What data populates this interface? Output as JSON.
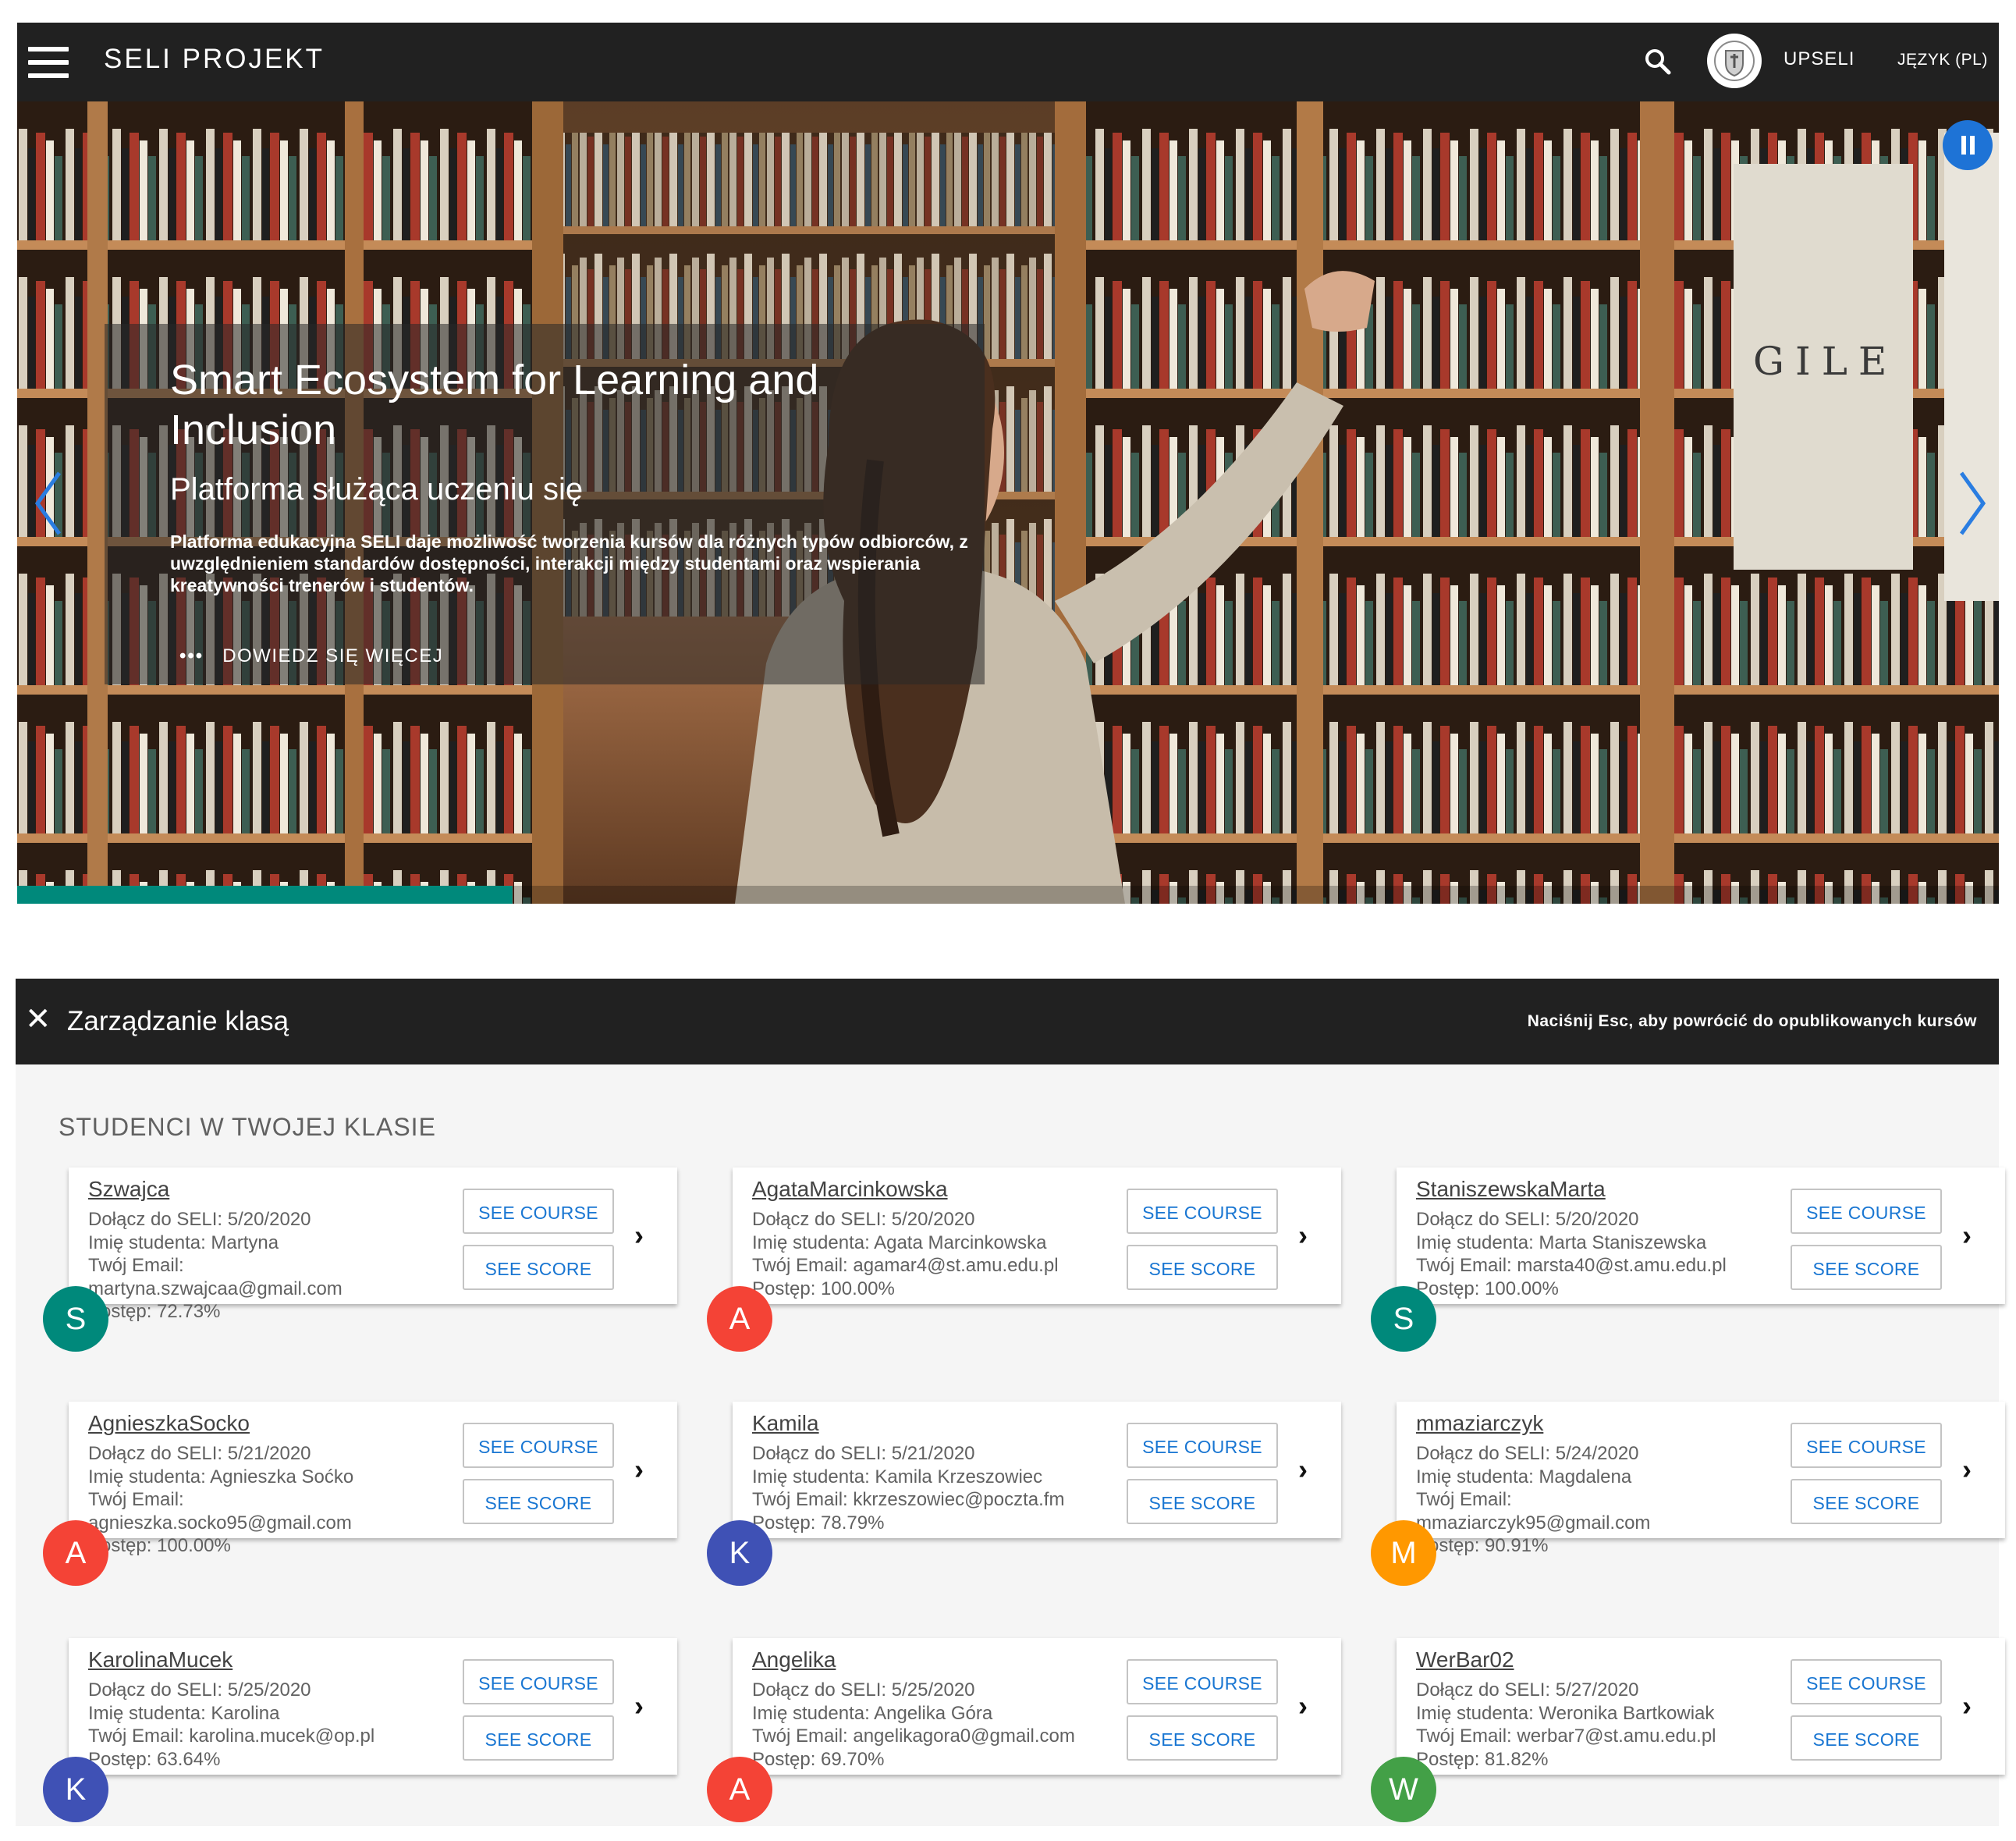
{
  "app": {
    "title": "SELI PROJEKT",
    "user_name": "UPSELI",
    "language": "JĘZYK (PL)"
  },
  "hero": {
    "title": "Smart Ecosystem for Learning and Inclusion",
    "subtitle": "Platforma służąca uczeniu się",
    "text": "Platforma edukacyjna SELI daje możliwość tworzenia kursów dla różnych typów odbiorców, z uwzględnieniem standardów dostępności, interakcji między studentami oraz wspierania kreatywności trenerów i studentów.",
    "more_dots": "•••",
    "more_label": "DOWIEDZ SIĘ WIĘCEJ",
    "slide_progress": 0.25,
    "shelf_sign": "GILE"
  },
  "class_management": {
    "close_glyph": "✕",
    "title": "Zarządzanie klasą",
    "hint": "Naciśnij Esc, aby powrócić do opublikowanych kursów",
    "section_title": "STUDENCI W TWOJEJ KLASIE"
  },
  "buttons": {
    "see_course": "SEE COURSE",
    "see_score": "SEE SCORE"
  },
  "students": [
    {
      "username": "Szwajca",
      "initial": "S",
      "color": "#00897b",
      "lines": [
        "Dołącz do SELI: 5/20/2020",
        "Imię studenta: Martyna",
        "Twój Email:",
        "martyna.szwajcaa@gmail.com",
        "Postęp: 72.73%"
      ]
    },
    {
      "username": "AgataMarcinkowska",
      "initial": "A",
      "color": "#f44336",
      "lines": [
        "Dołącz do SELI: 5/20/2020",
        "Imię studenta: Agata Marcinkowska",
        "Twój Email: agamar4@st.amu.edu.pl",
        "Postęp: 100.00%"
      ]
    },
    {
      "username": "StaniszewskaMarta",
      "initial": "S",
      "color": "#00897b",
      "lines": [
        "Dołącz do SELI: 5/20/2020",
        "Imię studenta: Marta Staniszewska",
        "Twój Email: marsta40@st.amu.edu.pl",
        "Postęp: 100.00%"
      ]
    },
    {
      "username": "AgnieszkaSocko",
      "initial": "A",
      "color": "#f44336",
      "lines": [
        "Dołącz do SELI: 5/21/2020",
        "Imię studenta: Agnieszka Soćko",
        "Twój Email:",
        "agnieszka.socko95@gmail.com",
        "Postęp: 100.00%"
      ]
    },
    {
      "username": "Kamila",
      "initial": "K",
      "color": "#3f51b5",
      "lines": [
        "Dołącz do SELI: 5/21/2020",
        "Imię studenta: Kamila Krzeszowiec",
        "Twój Email: kkrzeszowiec@poczta.fm",
        "Postęp: 78.79%"
      ]
    },
    {
      "username": "mmaziarczyk",
      "initial": "M",
      "color": "#ff9800",
      "lines": [
        "Dołącz do SELI: 5/24/2020",
        "Imię studenta: Magdalena",
        "Twój Email:",
        "mmaziarczyk95@gmail.com",
        "Postęp: 90.91%"
      ]
    },
    {
      "username": "KarolinaMucek",
      "initial": "K",
      "color": "#3f51b5",
      "lines": [
        "Dołącz do SELI: 5/25/2020",
        "Imię studenta: Karolina",
        "Twój Email: karolina.mucek@op.pl",
        "Postęp: 63.64%"
      ]
    },
    {
      "username": "Angelika",
      "initial": "A",
      "color": "#f44336",
      "lines": [
        "Dołącz do SELI: 5/25/2020",
        "Imię studenta: Angelika Góra",
        "Twój Email: angelikagora0@gmail.com",
        "Postęp: 69.70%"
      ]
    },
    {
      "username": "WerBar02",
      "initial": "W",
      "color": "#43a047",
      "lines": [
        "Dołącz do SELI: 5/27/2020",
        "Imię studenta: Weronika Bartkowiak",
        "Twój Email: werbar7@st.amu.edu.pl",
        "Postęp: 81.82%"
      ]
    }
  ]
}
